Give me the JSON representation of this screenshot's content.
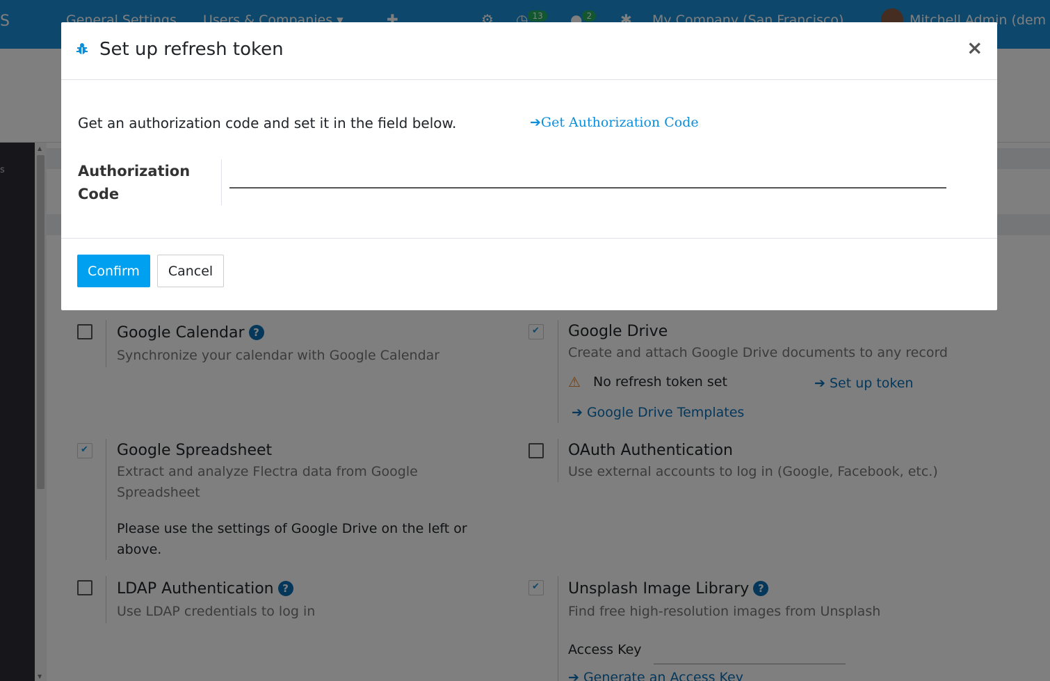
{
  "navbar": {
    "app_name": "S",
    "menu_general": "General Settings",
    "menu_users": "Users & Companies",
    "activity_count": "13",
    "messages_count": "2",
    "company": "My Company (San Francisco)",
    "user": "Mitchell Admin (dem"
  },
  "sidebar": {
    "label": "s"
  },
  "modal": {
    "title": "Set up refresh token",
    "close_symbol": "×",
    "instruction": "Get an authorization code and set it in the field below.",
    "auth_link_arrow": "➔",
    "auth_link": "Get Authorization Code",
    "field_label": "Authorization Code",
    "field_value": "",
    "confirm_label": "Confirm",
    "cancel_label": "Cancel"
  },
  "settings": {
    "google_calendar": {
      "title": "Google Calendar",
      "help": "?",
      "desc": "Synchronize your calendar with Google Calendar",
      "checked": false
    },
    "google_drive": {
      "title": "Google Drive",
      "desc": "Create and attach Google Drive documents to any record",
      "warning": "No refresh token set",
      "setup_link": "➔ Set up token",
      "templates_link": "➔ Google Drive Templates",
      "checked": true
    },
    "google_spreadsheet": {
      "title": "Google Spreadsheet",
      "desc_line1": "Extract and analyze Flectra data from Google",
      "desc_line2": "Spreadsheet",
      "note_line1": "Please use the settings of Google Drive on the left or",
      "note_line2": "above.",
      "checked": true
    },
    "oauth": {
      "title": "OAuth Authentication",
      "desc": "Use external accounts to log in (Google, Facebook, etc.)",
      "checked": false
    },
    "ldap": {
      "title": "LDAP Authentication",
      "help": "?",
      "desc": "Use LDAP credentials to log in",
      "checked": false
    },
    "unsplash": {
      "title": "Unsplash Image Library",
      "help": "?",
      "desc": "Find free high-resolution images from Unsplash",
      "access_key_label": "Access Key",
      "generate_link": "➔ Generate an Access Key",
      "checked": true
    }
  }
}
